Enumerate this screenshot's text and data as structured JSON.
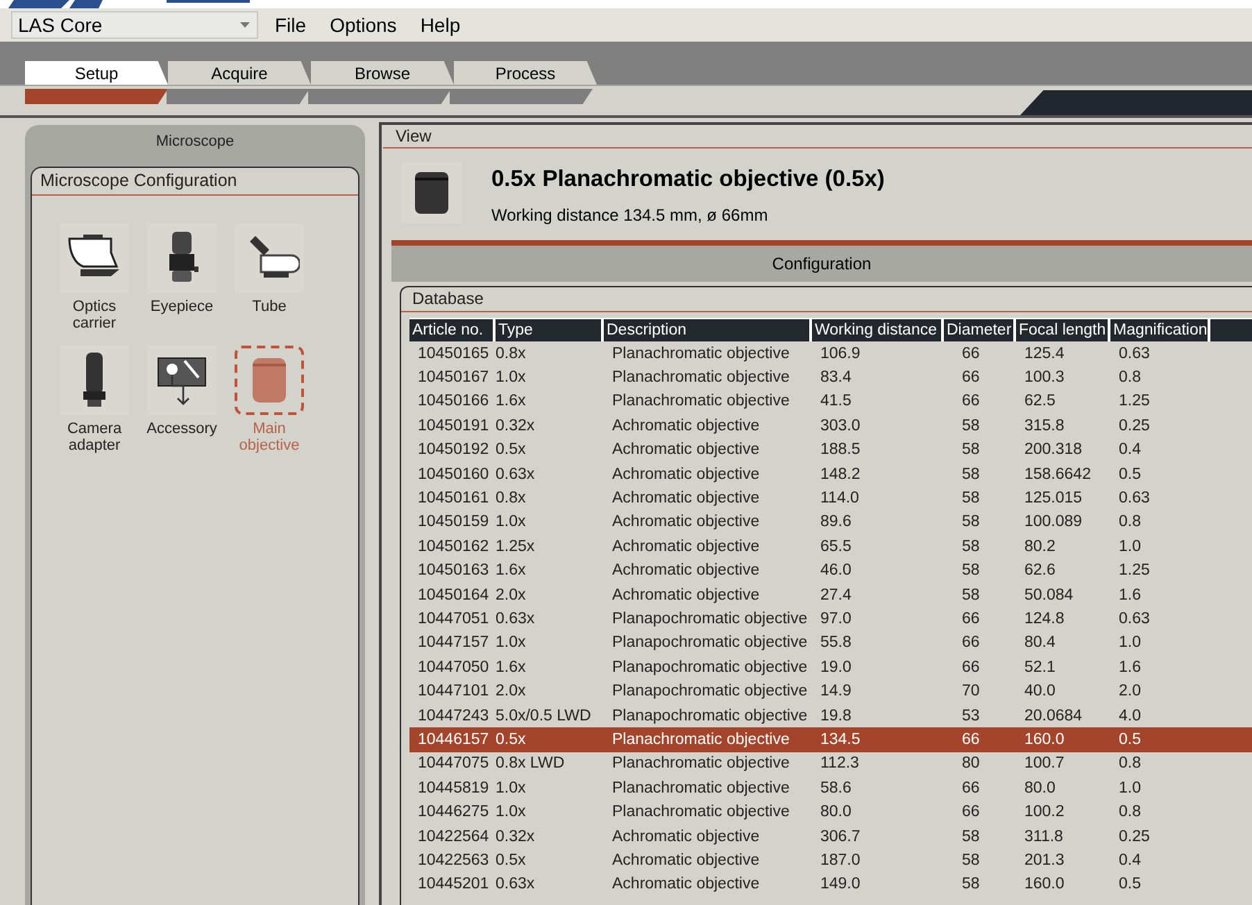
{
  "app": {
    "combo": "LAS Core",
    "menu": [
      "File",
      "Options",
      "Help"
    ]
  },
  "tabs": [
    {
      "label": "Setup",
      "selected": true
    },
    {
      "label": "Acquire",
      "selected": false
    },
    {
      "label": "Browse",
      "selected": false
    },
    {
      "label": "Process",
      "selected": false
    }
  ],
  "sidebar": {
    "title": "Microscope",
    "group": "Microscope Configuration",
    "items": [
      {
        "label": "Optics carrier",
        "kind": "optics-carrier",
        "selected": false
      },
      {
        "label": "Eyepiece",
        "kind": "eyepiece",
        "selected": false
      },
      {
        "label": "Tube",
        "kind": "tube",
        "selected": false
      },
      {
        "label": "Camera adapter",
        "kind": "camera-adapter",
        "selected": false
      },
      {
        "label": "Accessory",
        "kind": "accessory",
        "selected": false
      },
      {
        "label": "Main objective",
        "kind": "objective",
        "selected": true
      }
    ]
  },
  "view": {
    "title": "View",
    "heading": "0.5x Planachromatic objective (0.5x)",
    "subtitle": "Working distance 134.5 mm, ø 66mm"
  },
  "configuration": {
    "title": "Configuration"
  },
  "database": {
    "title": "Database",
    "columns": [
      "Article no.",
      "Type",
      "Description",
      "Working distance",
      "Diameter",
      "Focal length",
      "Magnification"
    ],
    "rows": [
      {
        "cells": [
          "10450165",
          "0.8x",
          "Planachromatic objective",
          "106.9",
          "66",
          "125.4",
          "0.63"
        ],
        "selected": false
      },
      {
        "cells": [
          "10450167",
          "1.0x",
          "Planachromatic objective",
          "83.4",
          "66",
          "100.3",
          "0.8"
        ],
        "selected": false
      },
      {
        "cells": [
          "10450166",
          "1.6x",
          "Planachromatic objective",
          "41.5",
          "66",
          "62.5",
          "1.25"
        ],
        "selected": false
      },
      {
        "cells": [
          "10450191",
          "0.32x",
          "Achromatic objective",
          "303.0",
          "58",
          "315.8",
          "0.25"
        ],
        "selected": false
      },
      {
        "cells": [
          "10450192",
          "0.5x",
          "Achromatic objective",
          "188.5",
          "58",
          "200.318",
          "0.4"
        ],
        "selected": false
      },
      {
        "cells": [
          "10450160",
          "0.63x",
          "Achromatic objective",
          "148.2",
          "58",
          "158.6642",
          "0.5"
        ],
        "selected": false
      },
      {
        "cells": [
          "10450161",
          "0.8x",
          "Achromatic objective",
          "114.0",
          "58",
          "125.015",
          "0.63"
        ],
        "selected": false
      },
      {
        "cells": [
          "10450159",
          "1.0x",
          "Achromatic objective",
          "89.6",
          "58",
          "100.089",
          "0.8"
        ],
        "selected": false
      },
      {
        "cells": [
          "10450162",
          "1.25x",
          "Achromatic objective",
          "65.5",
          "58",
          "80.2",
          "1.0"
        ],
        "selected": false
      },
      {
        "cells": [
          "10450163",
          "1.6x",
          "Achromatic objective",
          "46.0",
          "58",
          "62.6",
          "1.25"
        ],
        "selected": false
      },
      {
        "cells": [
          "10450164",
          "2.0x",
          "Achromatic objective",
          "27.4",
          "58",
          "50.084",
          "1.6"
        ],
        "selected": false
      },
      {
        "cells": [
          "10447051",
          "0.63x",
          "Planapochromatic objective",
          "97.0",
          "66",
          "124.8",
          "0.63"
        ],
        "selected": false
      },
      {
        "cells": [
          "10447157",
          "1.0x",
          "Planapochromatic objective",
          "55.8",
          "66",
          "80.4",
          "1.0"
        ],
        "selected": false
      },
      {
        "cells": [
          "10447050",
          "1.6x",
          "Planapochromatic objective",
          "19.0",
          "66",
          "52.1",
          "1.6"
        ],
        "selected": false
      },
      {
        "cells": [
          "10447101",
          "2.0x",
          "Planapochromatic objective",
          "14.9",
          "70",
          "40.0",
          "2.0"
        ],
        "selected": false
      },
      {
        "cells": [
          "10447243",
          "5.0x/0.5 LWD",
          "Planapochromatic objective",
          "19.8",
          "53",
          "20.0684",
          "4.0"
        ],
        "selected": false
      },
      {
        "cells": [
          "10446157",
          "0.5x",
          "Planachromatic objective",
          "134.5",
          "66",
          "160.0",
          "0.5"
        ],
        "selected": true
      },
      {
        "cells": [
          "10447075",
          "0.8x LWD",
          "Planachromatic objective",
          "112.3",
          "80",
          "100.7",
          "0.8"
        ],
        "selected": false
      },
      {
        "cells": [
          "10445819",
          "1.0x",
          "Planachromatic objective",
          "58.6",
          "66",
          "80.0",
          "1.0"
        ],
        "selected": false
      },
      {
        "cells": [
          "10446275",
          "1.0x",
          "Planachromatic objective",
          "80.0",
          "66",
          "100.2",
          "0.8"
        ],
        "selected": false
      },
      {
        "cells": [
          "10422564",
          "0.32x",
          "Achromatic objective",
          "306.7",
          "58",
          "311.8",
          "0.25"
        ],
        "selected": false
      },
      {
        "cells": [
          "10422563",
          "0.5x",
          "Achromatic objective",
          "187.0",
          "58",
          "201.3",
          "0.4"
        ],
        "selected": false
      },
      {
        "cells": [
          "10445201",
          "0.63x",
          "Achromatic objective",
          "149.0",
          "58",
          "160.0",
          "0.5"
        ],
        "selected": false
      }
    ]
  }
}
